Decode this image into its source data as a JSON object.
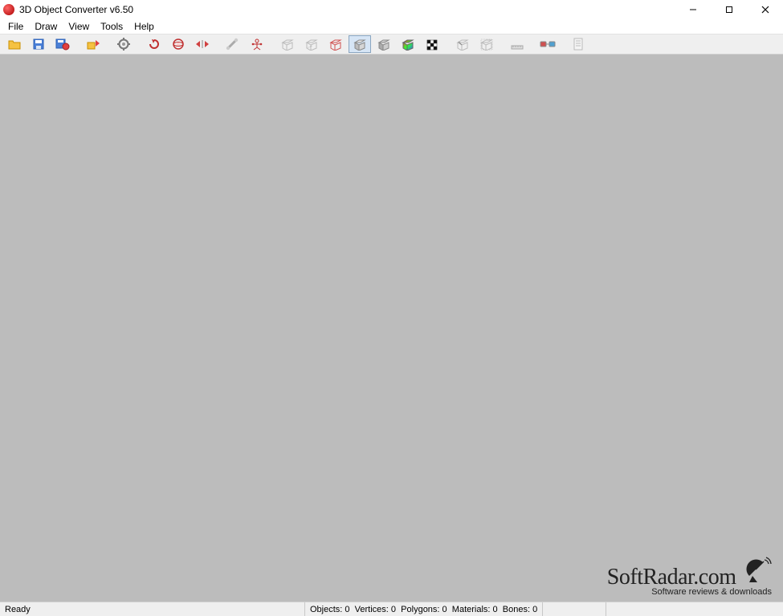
{
  "window": {
    "title": "3D Object Converter v6.50"
  },
  "menu": {
    "items": [
      "File",
      "Draw",
      "View",
      "Tools",
      "Help"
    ]
  },
  "toolbar": {
    "buttons": [
      {
        "name": "open-folder-icon"
      },
      {
        "name": "save-icon"
      },
      {
        "name": "save-as-icon"
      },
      {
        "sep": true
      },
      {
        "name": "batch-convert-icon"
      },
      {
        "sep": true
      },
      {
        "name": "settings-gear-icon"
      },
      {
        "sep": true
      },
      {
        "name": "rotate-icon"
      },
      {
        "name": "orbit-icon"
      },
      {
        "name": "flip-icon"
      },
      {
        "sep": true
      },
      {
        "name": "bone-tool-icon"
      },
      {
        "name": "skeleton-icon"
      },
      {
        "sep": true
      },
      {
        "name": "wireframe-view-icon"
      },
      {
        "name": "hiddenline-view-icon"
      },
      {
        "name": "wireframe-red-view-icon"
      },
      {
        "name": "flat-shade-view-icon",
        "pressed": true
      },
      {
        "name": "smooth-shade-view-icon"
      },
      {
        "name": "color-shade-view-icon"
      },
      {
        "name": "checker-texture-view-icon"
      },
      {
        "sep": true
      },
      {
        "name": "normals-view-icon"
      },
      {
        "name": "bounding-box-icon"
      },
      {
        "sep": true
      },
      {
        "name": "measure-tool-icon"
      },
      {
        "sep": true
      },
      {
        "name": "glasses-3d-icon"
      },
      {
        "sep": true
      },
      {
        "name": "info-list-icon"
      }
    ]
  },
  "status": {
    "ready": "Ready",
    "objects_label": "Objects:",
    "objects": 0,
    "vertices_label": "Vertices:",
    "vertices": 0,
    "polygons_label": "Polygons:",
    "polygons": 0,
    "materials_label": "Materials:",
    "materials": 0,
    "bones_label": "Bones:",
    "bones": 0
  },
  "watermark": {
    "title": "SoftRadar.com",
    "subtitle": "Software reviews & downloads"
  }
}
